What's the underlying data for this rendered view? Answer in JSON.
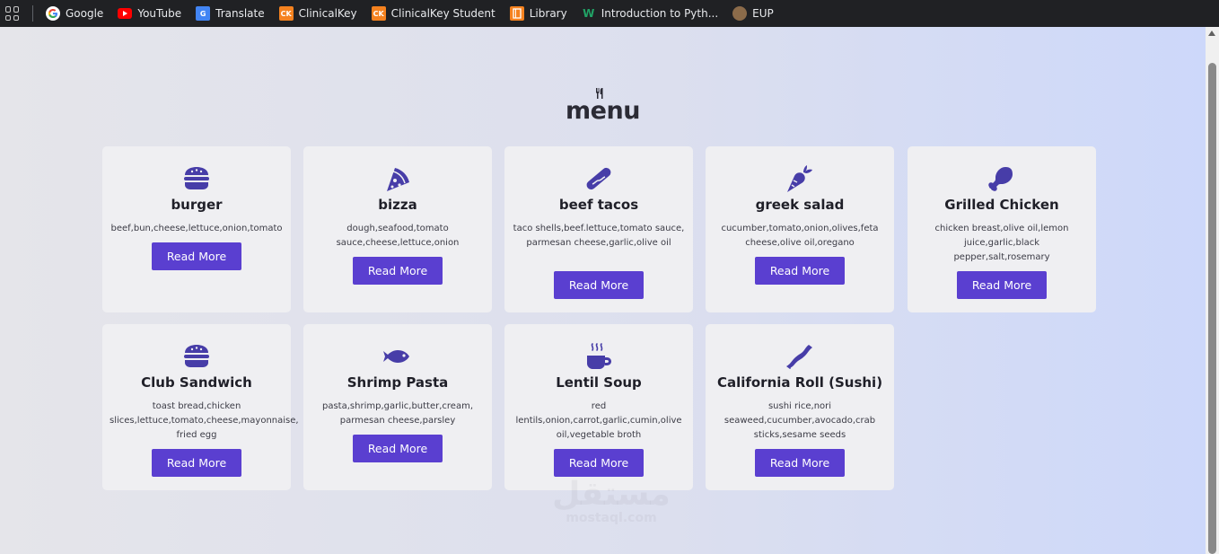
{
  "bookmarks": [
    {
      "label": "Google",
      "icon": "google-icon",
      "color": "#ffffff"
    },
    {
      "label": "YouTube",
      "icon": "youtube-icon",
      "color": "#ff0000"
    },
    {
      "label": "Translate",
      "icon": "translate-icon",
      "color": "#4285f4"
    },
    {
      "label": "ClinicalKey",
      "icon": "clinicalkey-icon",
      "color": "#f5821f"
    },
    {
      "label": "ClinicalKey Student",
      "icon": "clinicalkey-student-icon",
      "color": "#f5821f"
    },
    {
      "label": "Library",
      "icon": "library-icon",
      "color": "#f5821f"
    },
    {
      "label": "Introduction to Pyth...",
      "icon": "w-icon",
      "color": "#21a366"
    },
    {
      "label": "EUP",
      "icon": "eup-icon",
      "color": "#8b6b4a"
    }
  ],
  "page": {
    "heading_icon": "utensils-icon",
    "heading": "menu",
    "accent": "#5a3fd0",
    "button_label": "Read More"
  },
  "cards": [
    {
      "name": "burger",
      "icon": "burger-icon",
      "ingredients": "beef,bun,cheese,lettuce,onion,tomato",
      "button": "Read More"
    },
    {
      "name": "bizza",
      "icon": "pizza-slice-icon",
      "ingredients": "dough,seafood,tomato sauce,cheese,lettuce,onion",
      "button": "Read More"
    },
    {
      "name": "beef tacos",
      "icon": "hotdog-icon",
      "ingredients": "taco shells,beef.lettuce,tomato sauce, parmesan cheese,garlic,olive oil",
      "button": "Read More"
    },
    {
      "name": "greek salad",
      "icon": "carrot-icon",
      "ingredients": "cucumber,tomato,onion,olives,feta cheese,olive oil,oregano",
      "button": "Read More"
    },
    {
      "name": "Grilled Chicken",
      "icon": "drumstick-icon",
      "ingredients": "chicken breast,olive oil,lemon juice,garlic,black pepper,salt,rosemary",
      "button": "Read More"
    },
    {
      "name": "Club Sandwich",
      "icon": "burger-icon",
      "ingredients": "toast bread,chicken slices,lettuce,tomato,cheese,mayonnaise, fried egg",
      "button": "Read More"
    },
    {
      "name": "Shrimp Pasta",
      "icon": "fish-icon",
      "ingredients": "pasta,shrimp,garlic,butter,cream, parmesan cheese,parsley",
      "button": "Read More"
    },
    {
      "name": "Lentil Soup",
      "icon": "mug-hot-icon",
      "ingredients": "red lentils,onion,carrot,garlic,cumin,olive oil,vegetable broth",
      "button": "Read More"
    },
    {
      "name": "California Roll (Sushi)",
      "icon": "bacon-icon",
      "ingredients": "sushi rice,nori seaweed,cucumber,avocado,crab sticks,sesame seeds",
      "button": "Read More"
    }
  ],
  "watermark": {
    "main": "مستقل",
    "sub": "mostaql.com"
  }
}
